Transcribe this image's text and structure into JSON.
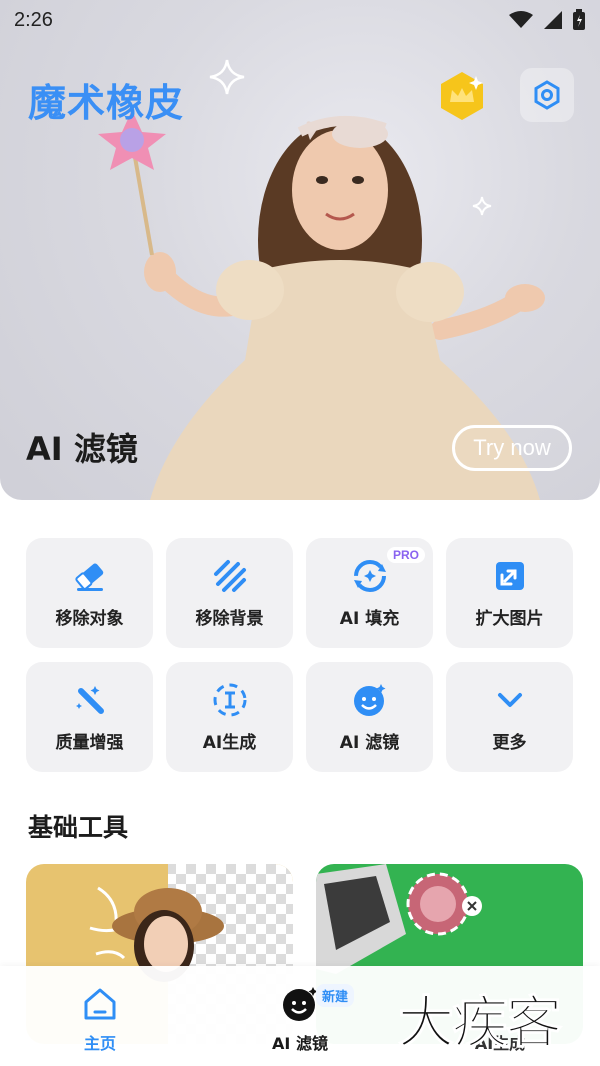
{
  "status": {
    "time": "2:26"
  },
  "hero": {
    "app_title": "魔术橡皮",
    "feature_title": "AI 滤镜",
    "try_button": "Try now"
  },
  "tools": [
    {
      "label": "移除对象",
      "icon": "eraser-icon"
    },
    {
      "label": "移除背景",
      "icon": "stripes-icon"
    },
    {
      "label": "AI 填充",
      "icon": "refresh-fill-icon",
      "badge": "PRO"
    },
    {
      "label": "扩大图片",
      "icon": "expand-image-icon"
    },
    {
      "label": "质量增强",
      "icon": "magic-wand-icon"
    },
    {
      "label": "AI生成",
      "icon": "text-cursor-icon"
    },
    {
      "label": "AI 滤镜",
      "icon": "smiley-icon"
    },
    {
      "label": "更多",
      "icon": "chevron-down-icon"
    }
  ],
  "basic_tools_title": "基础工具",
  "nav": {
    "home": "主页",
    "filter": "AI 滤镜",
    "new_badge": "新建",
    "generate": "AI生成"
  },
  "watermark": "大疾客",
  "colors": {
    "accent": "#2f8ef5",
    "tile": "#f1f1f3",
    "icon": "#2f8ef5"
  }
}
